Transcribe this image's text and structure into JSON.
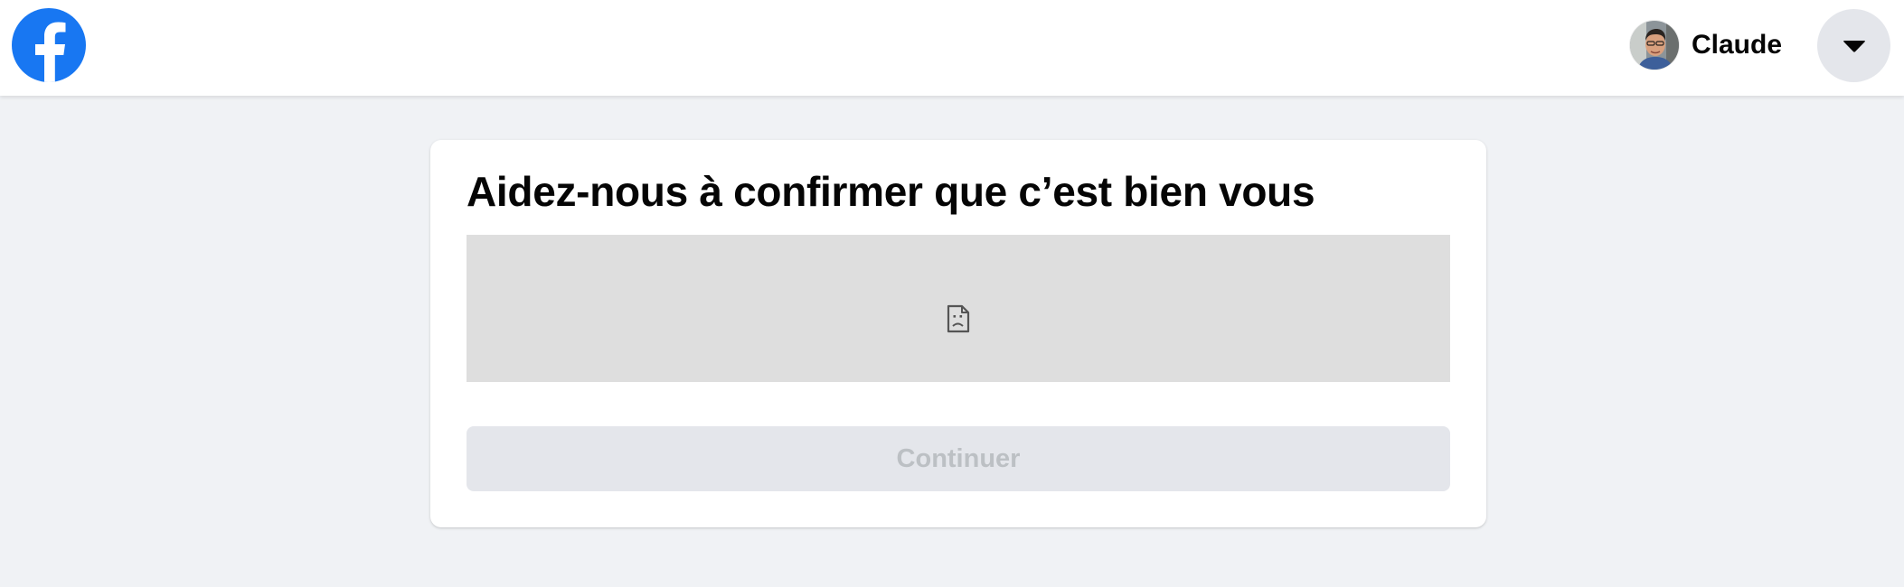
{
  "header": {
    "logo_icon": "facebook-logo",
    "brand_color": "#1877f2",
    "profile": {
      "name": "Claude",
      "avatar_icon": "user-avatar"
    },
    "menu_icon": "caret-down-icon"
  },
  "card": {
    "title": "Aidez-nous à confirmer que c’est bien vous",
    "captcha_icon": "broken-image-icon",
    "continue_label": "Continuer",
    "continue_disabled": true
  },
  "colors": {
    "page_background": "#f0f2f5",
    "captcha_background": "#dedede",
    "button_disabled_bg": "#e4e6eb",
    "button_disabled_text": "#bcc0c4"
  }
}
